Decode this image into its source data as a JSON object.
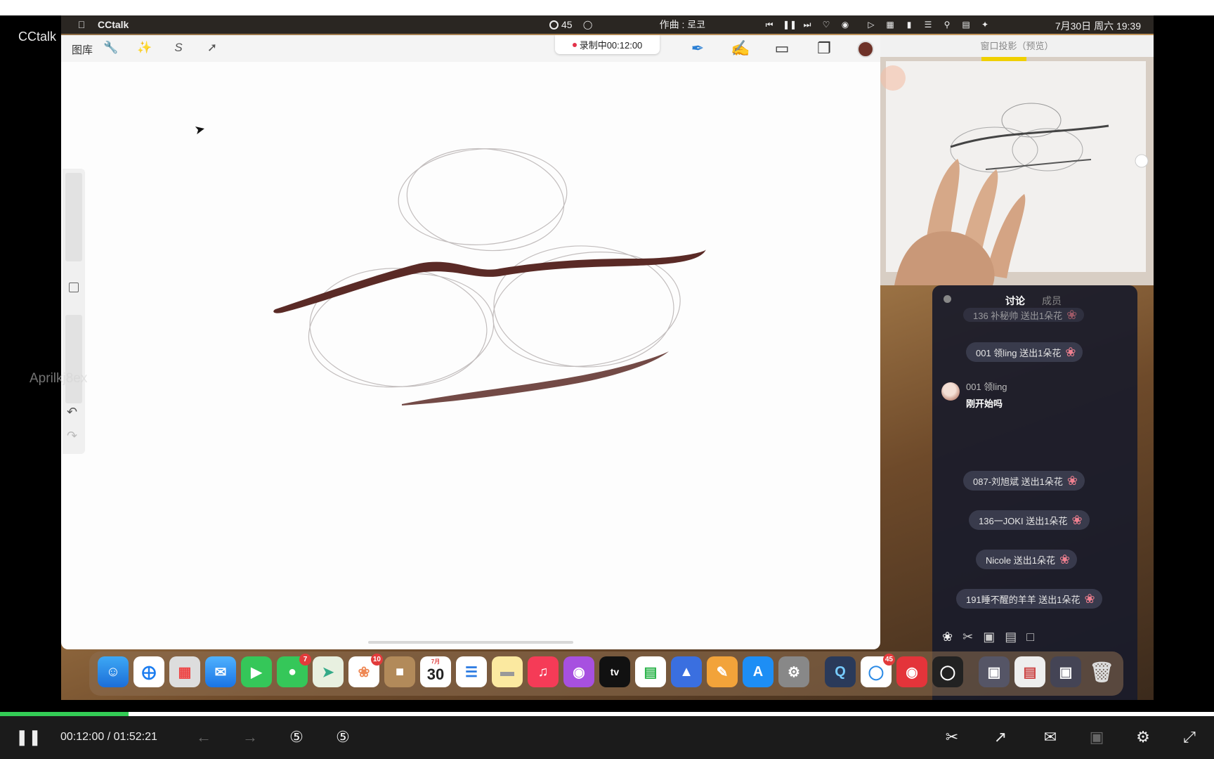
{
  "overlay": {
    "app_title": "CCtalk",
    "watermark": "Aprilkj8ex"
  },
  "menubar": {
    "apple_icon": "apple-icon",
    "app_name": "CCtalk",
    "counter": "45",
    "song": "作曲 : 로코",
    "clock": "7月30日 周六 19:39"
  },
  "procreate": {
    "gallery_label": "图库",
    "recording_label": "录制中00:12:00",
    "tools": [
      "wrench-icon",
      "magic-wand-icon",
      "selection-icon",
      "transform-arrow-icon"
    ],
    "right_tools": [
      "brush-icon",
      "smudge-icon",
      "eraser-icon",
      "layers-icon"
    ],
    "color": "#6e3228",
    "stroke_color": "#5a2a26"
  },
  "preview": {
    "title": "窗口投影（预览）"
  },
  "chat": {
    "tab_active": "讨论",
    "tab_other": "成员",
    "gifts": [
      "136 补秘帅 送出1朵花",
      "001 领ling 送出1朵花",
      "087-刘旭斌 送出1朵花",
      "136一JOKI 送出1朵花",
      "Nicole 送出1朵花",
      "191睡不醒的羊羊 送出1朵花"
    ],
    "message": {
      "author": "001 领ling",
      "text": "刚开始吗"
    }
  },
  "dock": {
    "calendar_month": "7月",
    "calendar_day": "30",
    "messages_badge": "7",
    "photos_badge": "10",
    "cctalk_badge": "45"
  },
  "player": {
    "current_time": "00:12:00",
    "separator": "/",
    "total_time": "01:52:21",
    "progress": 0.106
  }
}
